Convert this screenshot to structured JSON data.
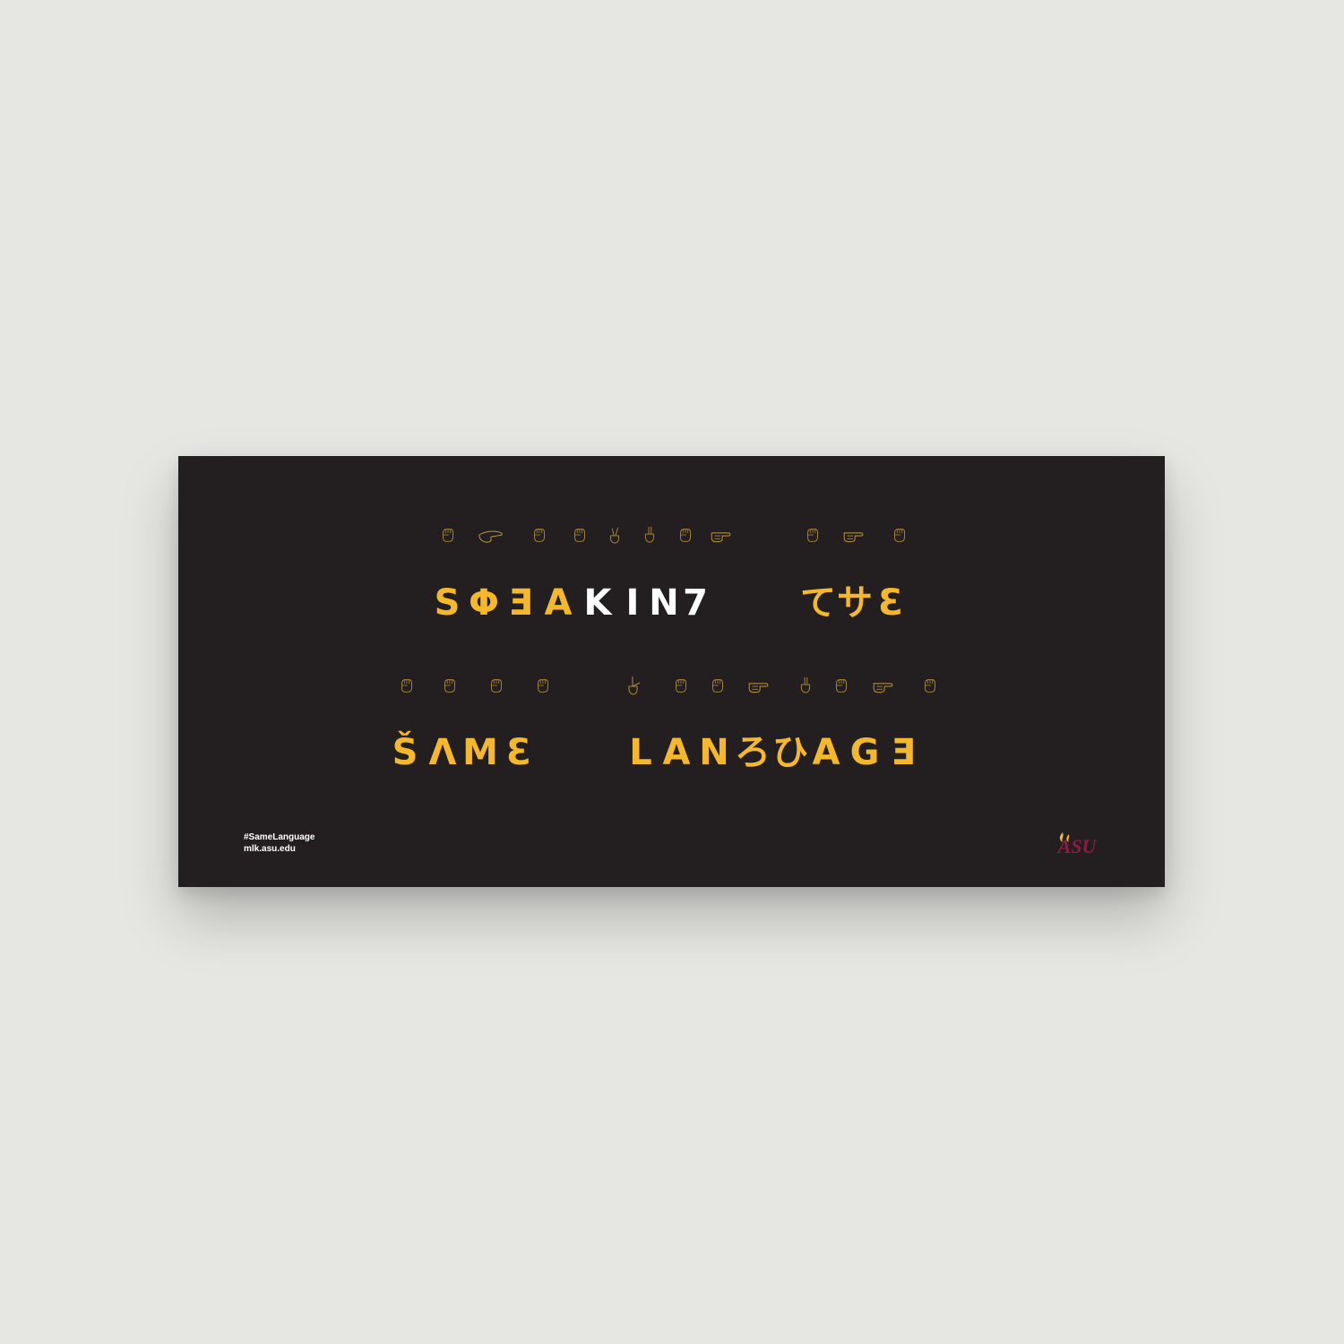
{
  "banner": {
    "line1": {
      "words": [
        {
          "glyphs": [
            "S",
            "Φ",
            "Ǝ",
            "A",
            "K",
            "I",
            "N",
            "7"
          ],
          "white": [
            4,
            5,
            6,
            7
          ]
        },
        {
          "glyphs": [
            "て",
            "サ",
            "Ɛ"
          ],
          "white": []
        }
      ]
    },
    "line2": {
      "words": [
        {
          "glyphs": [
            "Š",
            "Λ",
            "M",
            "Ɛ"
          ],
          "white": []
        },
        {
          "glyphs": [
            "L",
            "A",
            "N",
            "ろ",
            "ひ",
            "A",
            "G",
            "Ǝ"
          ],
          "white": []
        }
      ]
    },
    "hashtag": "#SameLanguage",
    "url": "mlk.asu.edu",
    "logo_text": "ASU"
  },
  "colors": {
    "background": "#e6e6e2",
    "banner": "#231f20",
    "gold": "#f5b82b",
    "white": "#ffffff",
    "maroon": "#8c1d40",
    "hand_outline": "#b08a3c"
  },
  "icons": {
    "hands": "fingerspelling-hand-icons"
  }
}
